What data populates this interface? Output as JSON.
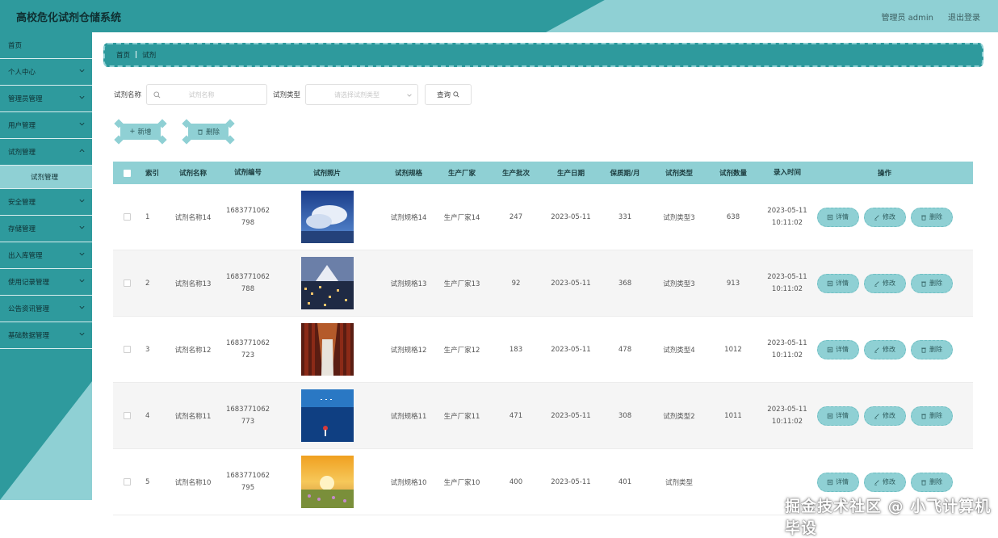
{
  "header": {
    "title": "高校危化试剂仓储系统",
    "user": "管理员 admin",
    "logout": "退出登录"
  },
  "sidebar": {
    "items": [
      {
        "label": "首页",
        "chevron": false
      },
      {
        "label": "个人中心",
        "chevron": true
      },
      {
        "label": "管理员管理",
        "chevron": true
      },
      {
        "label": "用户管理",
        "chevron": true
      },
      {
        "label": "试剂管理",
        "chevron": true,
        "expanded": true
      },
      {
        "label": "试剂管理",
        "sub": true
      },
      {
        "label": "安全管理",
        "chevron": true
      },
      {
        "label": "存储管理",
        "chevron": true
      },
      {
        "label": "出入库管理",
        "chevron": true
      },
      {
        "label": "使用记录管理",
        "chevron": true
      },
      {
        "label": "公告资讯管理",
        "chevron": true
      },
      {
        "label": "基础数据管理",
        "chevron": true
      }
    ]
  },
  "breadcrumb": {
    "home": "首页",
    "current": "试剂"
  },
  "search": {
    "name_label": "试剂名称",
    "name_placeholder": "试剂名称",
    "type_label": "试剂类型",
    "type_placeholder": "请选择试剂类型",
    "query_label": "查询"
  },
  "actions": {
    "add_label": "新增",
    "delete_label": "删除"
  },
  "table": {
    "headers": [
      "索引",
      "试剂名称",
      "试剂编号",
      "试剂照片",
      "试剂规格",
      "生产厂家",
      "生产批次",
      "生产日期",
      "保质期/月",
      "试剂类型",
      "试剂数量",
      "录入时间",
      "操作"
    ],
    "op_labels": {
      "detail": "详情",
      "edit": "修改",
      "delete": "删除"
    },
    "rows": [
      {
        "index": "1",
        "name": "试剂名称14",
        "code1": "1683771062",
        "code2": "798",
        "photo": "sky",
        "spec": "试剂规格14",
        "maker": "生产厂家14",
        "batch": "247",
        "date": "2023-05-11",
        "shelf": "331",
        "type": "试剂类型3",
        "qty": "638",
        "time1": "2023-05-11",
        "time2": "10:11:02"
      },
      {
        "index": "2",
        "name": "试剂名称13",
        "code1": "1683771062",
        "code2": "788",
        "photo": "city",
        "spec": "试剂规格13",
        "maker": "生产厂家13",
        "batch": "92",
        "date": "2023-05-11",
        "shelf": "368",
        "type": "试剂类型3",
        "qty": "913",
        "time1": "2023-05-11",
        "time2": "10:11:02"
      },
      {
        "index": "3",
        "name": "试剂名称12",
        "code1": "1683771062",
        "code2": "723",
        "photo": "corridor",
        "spec": "试剂规格12",
        "maker": "生产厂家12",
        "batch": "183",
        "date": "2023-05-11",
        "shelf": "478",
        "type": "试剂类型4",
        "qty": "1012",
        "time1": "2023-05-11",
        "time2": "10:11:02"
      },
      {
        "index": "4",
        "name": "试剂名称11",
        "code1": "1683771062",
        "code2": "773",
        "photo": "sea",
        "spec": "试剂规格11",
        "maker": "生产厂家11",
        "batch": "471",
        "date": "2023-05-11",
        "shelf": "308",
        "type": "试剂类型2",
        "qty": "1011",
        "time1": "2023-05-11",
        "time2": "10:11:02"
      },
      {
        "index": "5",
        "name": "试剂名称10",
        "code1": "1683771062",
        "code2": "795",
        "photo": "sunset",
        "spec": "试剂规格10",
        "maker": "生产厂家10",
        "batch": "400",
        "date": "2023-05-11",
        "shelf": "401",
        "type": "试剂类型",
        "qty": "",
        "time1": "",
        "time2": ""
      }
    ]
  },
  "watermark": "掘金技术社区 @ 小飞计算机毕设"
}
